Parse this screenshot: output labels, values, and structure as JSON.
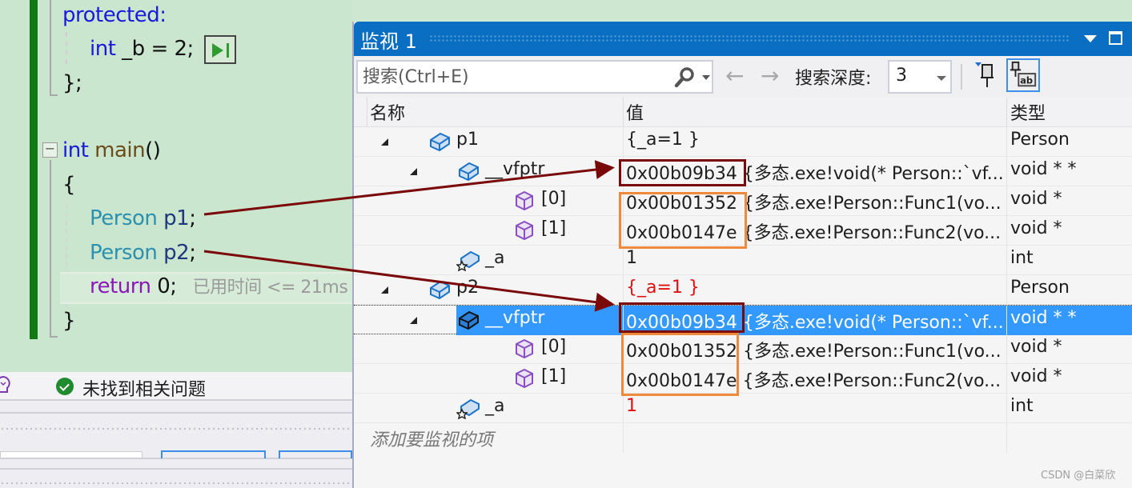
{
  "editor": {
    "lines": {
      "protected": "protected:",
      "int_b_kw": "int",
      "int_b_rest": " _b = 2;",
      "close_class": "};",
      "main_kw": "int",
      "main_name": " main",
      "main_parens": "()",
      "open_brace": "{",
      "p1_type": "Person",
      "p1_var": " p1",
      "p1_semi": ";",
      "p2_type": "Person",
      "p2_var": " p2",
      "p2_semi": ";",
      "return_kw": "return",
      "return_rest": " 0;",
      "elapsed_hint": "已用时间 <= 21ms",
      "close_brace": "}"
    }
  },
  "status": {
    "issues_text": "未找到相关问题"
  },
  "watch": {
    "title": "监视 1",
    "search": {
      "placeholder": "搜索(Ctrl+E)",
      "value": ""
    },
    "nav": {
      "back": "←",
      "forward": "→"
    },
    "depth_label": "搜索深度:",
    "depth_value": "3",
    "columns": {
      "name": "名称",
      "value": "值",
      "type": "类型"
    },
    "rows": [
      {
        "name": "p1",
        "value": "{_a=1 }",
        "type": "Person",
        "level": 0,
        "expanded": true,
        "icon": "object-icon",
        "value_changed": false
      },
      {
        "name": "__vfptr",
        "value": "0x00b09b34 {多态.exe!void(* Person::`vf...",
        "type": "void * *",
        "level": 1,
        "expanded": true,
        "icon": "object-icon",
        "value_changed": false
      },
      {
        "name": "[0]",
        "value": "0x00b01352 {多态.exe!Person::Func1(vo...",
        "type": "void *",
        "level": 2,
        "expanded": false,
        "icon": "element-icon",
        "value_changed": false
      },
      {
        "name": "[1]",
        "value": "0x00b0147e {多态.exe!Person::Func2(vo...",
        "type": "void *",
        "level": 2,
        "expanded": false,
        "icon": "element-icon",
        "value_changed": false
      },
      {
        "name": "_a",
        "value": "1",
        "type": "int",
        "level": 1,
        "expanded": false,
        "icon": "protected-field-icon",
        "value_changed": false
      },
      {
        "name": "p2",
        "value": "{_a=1 }",
        "type": "Person",
        "level": 0,
        "expanded": true,
        "icon": "object-icon",
        "value_changed": true
      },
      {
        "name": "__vfptr",
        "value": "0x00b09b34 {多态.exe!void(* Person::`vf...",
        "type": "void * *",
        "level": 1,
        "expanded": true,
        "icon": "object-icon",
        "value_changed": false,
        "selected": true
      },
      {
        "name": "[0]",
        "value": "0x00b01352 {多态.exe!Person::Func1(vo...",
        "type": "void *",
        "level": 2,
        "expanded": false,
        "icon": "element-icon",
        "value_changed": false
      },
      {
        "name": "[1]",
        "value": "0x00b0147e {多态.exe!Person::Func2(vo...",
        "type": "void *",
        "level": 2,
        "expanded": false,
        "icon": "element-icon",
        "value_changed": false
      },
      {
        "name": "_a",
        "value": "1",
        "type": "int",
        "level": 1,
        "expanded": false,
        "icon": "protected-field-icon",
        "value_changed": true
      }
    ],
    "add_watch_placeholder": "添加要监视的项"
  },
  "colors": {
    "title_bar": "#0a6ec2",
    "selection": "#3399ff",
    "annotation_dark": "#7a0a0a",
    "annotation_orange": "#f08a3a",
    "changed_value": "#e01010"
  },
  "watermark": "CSDN @白菜欣"
}
